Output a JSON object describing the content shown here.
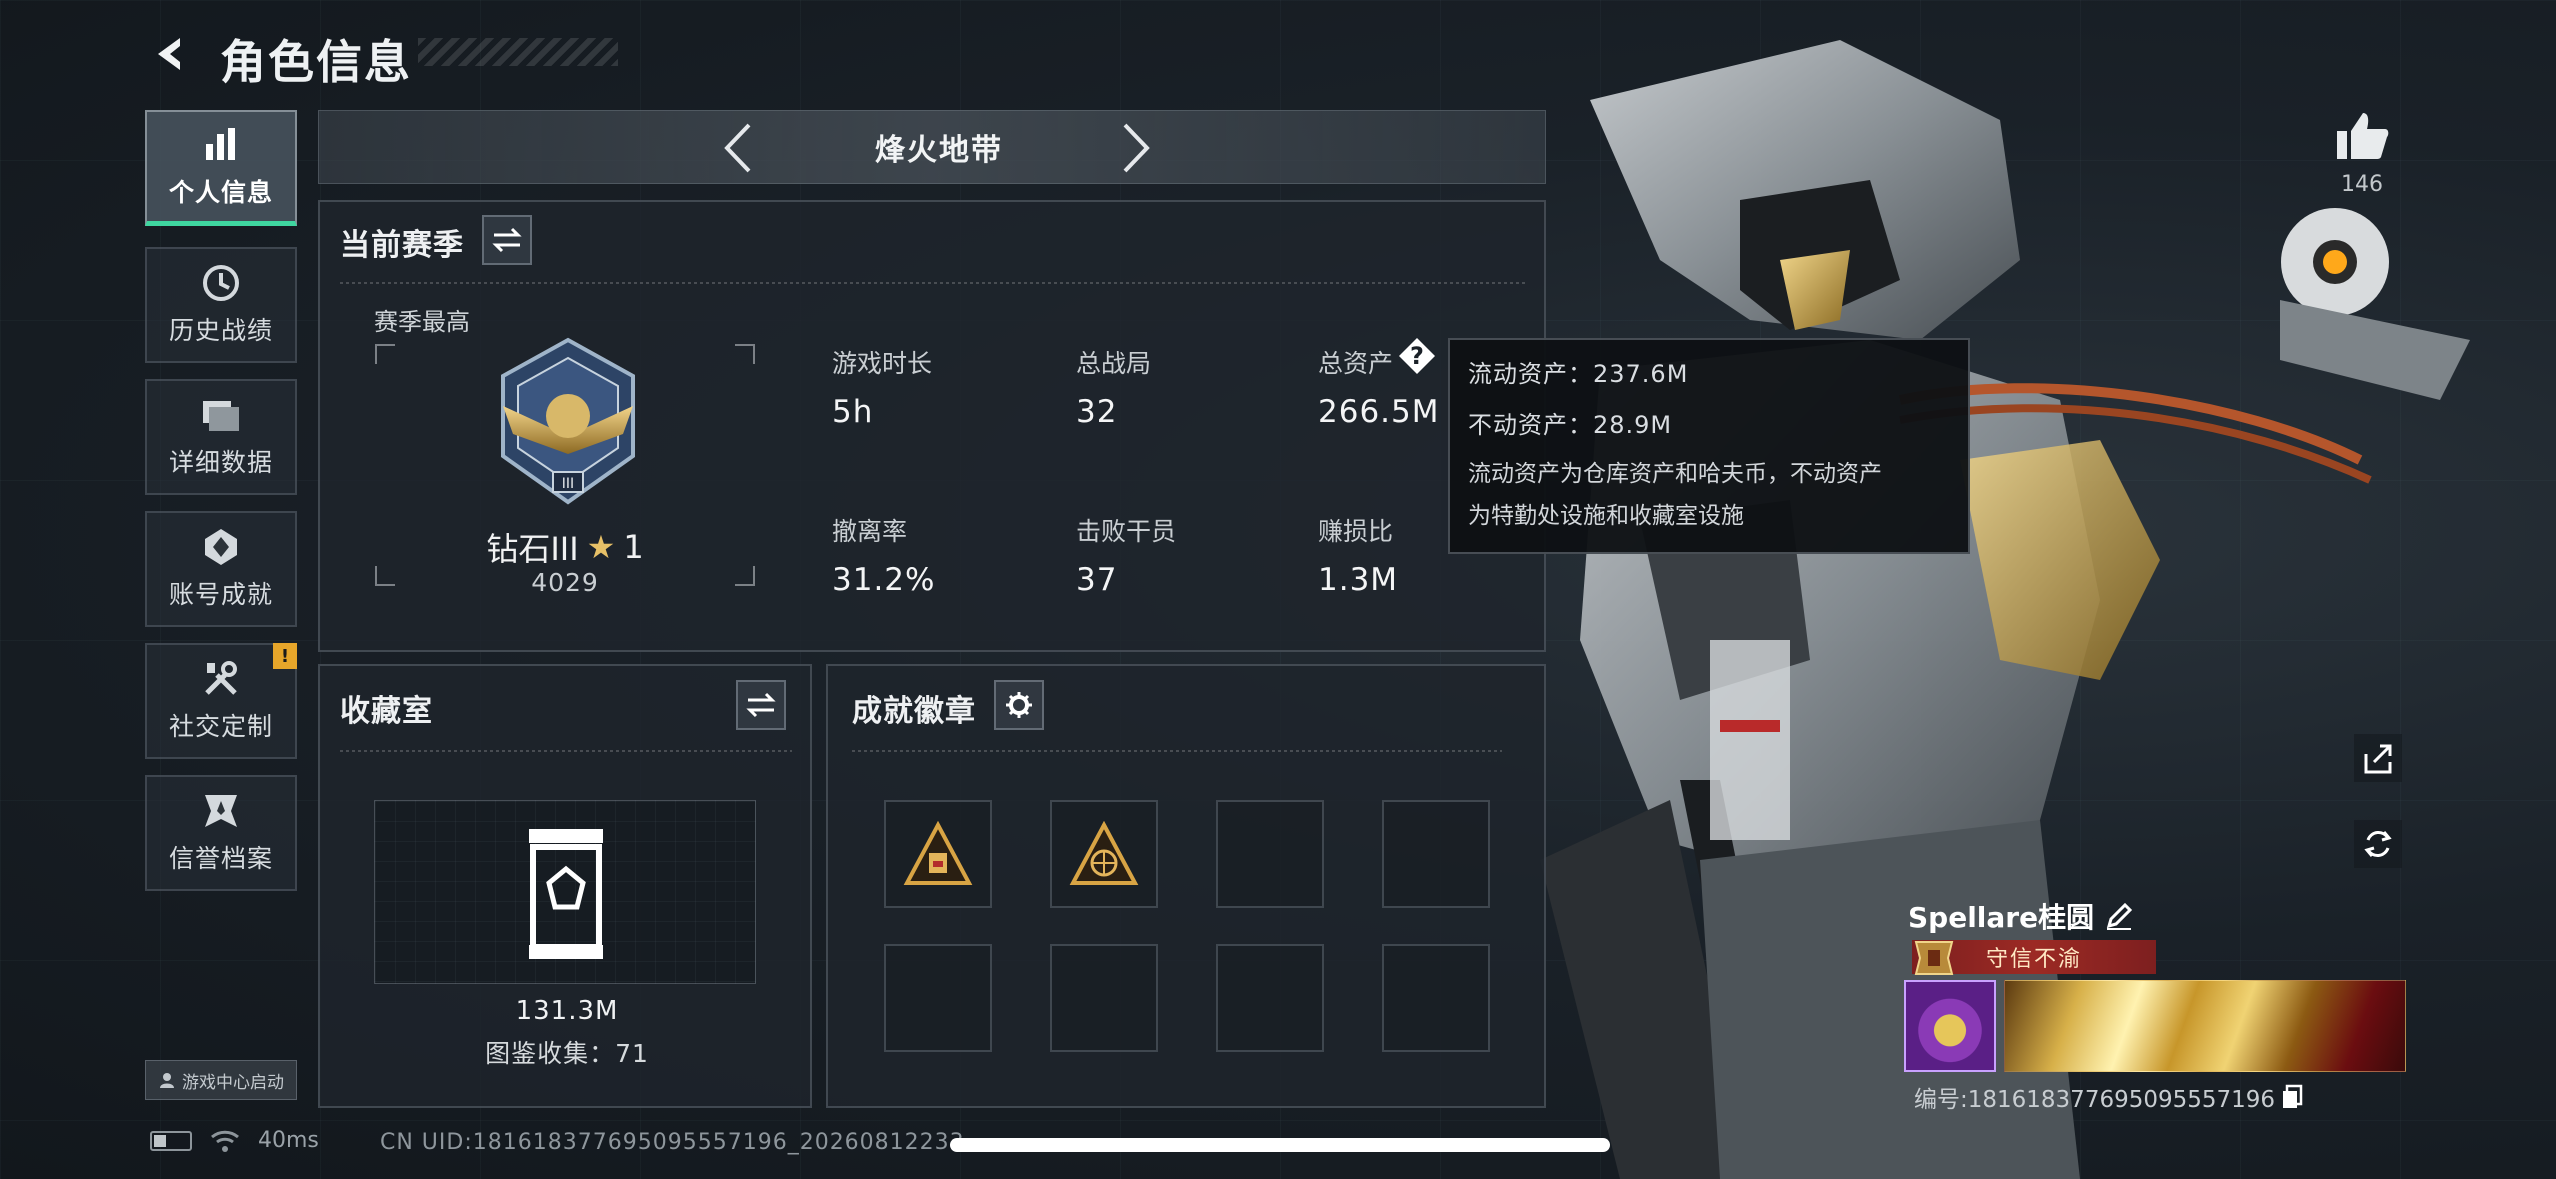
{
  "header": {
    "title": "角色信息"
  },
  "nav": {
    "items": [
      {
        "label": "个人信息",
        "icon": "bar-chart-icon",
        "active": true
      },
      {
        "label": "历史战绩",
        "icon": "history-clock-icon"
      },
      {
        "label": "详细数据",
        "icon": "folder-icon"
      },
      {
        "label": "账号成就",
        "icon": "achievement-icon"
      },
      {
        "label": "社交定制",
        "icon": "tools-icon",
        "alert": "!"
      },
      {
        "label": "信誉档案",
        "icon": "reputation-icon"
      }
    ],
    "game_center": "游戏中心启动"
  },
  "map": {
    "name": "烽火地带"
  },
  "season": {
    "title": "当前赛季",
    "best_label": "赛季最高",
    "rank_name": "钻石III",
    "rank_stars": "1",
    "rank_score": "4029",
    "stats": {
      "play_time": {
        "label": "游戏时长",
        "value": "5h"
      },
      "total_games": {
        "label": "总战局",
        "value": "32"
      },
      "total_assets": {
        "label": "总资产",
        "value": "266.5M"
      },
      "extract_rate": {
        "label": "撤离率",
        "value": "31.2%"
      },
      "kills": {
        "label": "击败干员",
        "value": "37"
      },
      "profit_ratio": {
        "label": "赚损比",
        "value": "1.3M"
      }
    },
    "help": "?"
  },
  "tooltip": {
    "liquid": "流动资产：237.6M",
    "fixed": "不动资产：28.9M",
    "note_line1": "流动资产为仓库资产和哈夫币，不动资产",
    "note_line2": "为特勤处设施和收藏室设施"
  },
  "collection": {
    "title": "收藏室",
    "value": "131.3M",
    "count": "图鉴收集：71"
  },
  "badges": {
    "title": "成就徽章"
  },
  "profile": {
    "likes": "146",
    "player_name": "Spellare桂圆",
    "title_tag": "守信不渝",
    "player_id": "编号:1816183776950955571​96"
  },
  "status": {
    "ping": "40ms",
    "uid": "CN UID:1816183776950955571​96_2026081223​3"
  },
  "colors": {
    "accent": "#3fd6a0",
    "alert": "#e7a62a",
    "title_tag": "#9c2a24"
  }
}
